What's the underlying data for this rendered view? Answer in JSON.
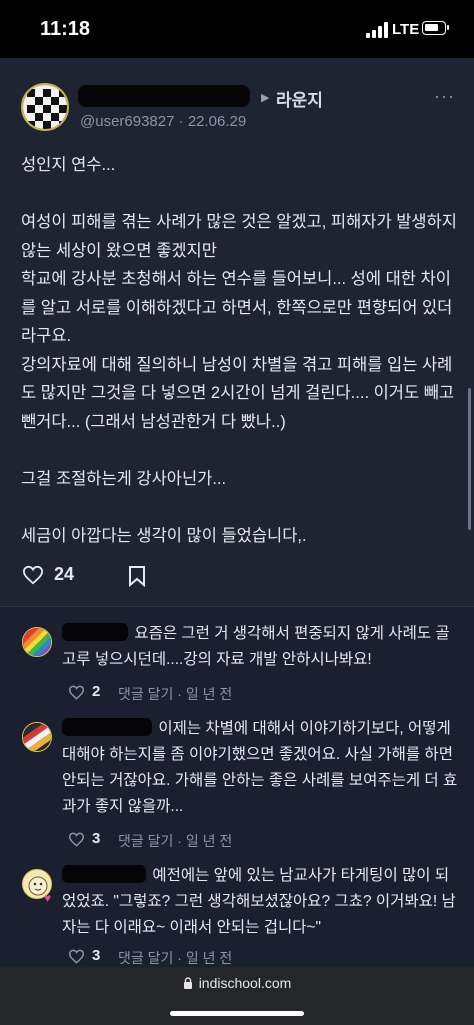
{
  "status_bar": {
    "time": "11:18",
    "network": "LTE"
  },
  "post": {
    "board": "라운지",
    "handle": "@user693827",
    "date": "22.06.29",
    "more": "···",
    "body": [
      "성인지 연수...",
      "",
      "여성이 피해를 겪는 사례가 많은 것은 알겠고, 피해자가 발생하지 않는 세상이 왔으면 좋겠지만",
      "학교에 강사분 초청해서 하는 연수를 들어보니... 성에 대한 차이를 알고 서로를 이해하겠다고 하면서, 한쪽으로만 편향되어 있더라구요.",
      "강의자료에 대해 질의하니 남성이 차별을 겪고 피해를 입는 사례도 많지만 그것을 다 넣으면 2시간이 넘게 걸린다.... 이거도 빼고 뺀거다... (그래서 남성관한거 다 빴나..)",
      "",
      "그걸 조절하는게 강사아닌가...",
      "",
      "세금이 아깝다는 생각이 많이 들었습니다,."
    ],
    "like_count": "24"
  },
  "comments": [
    {
      "text": "요즘은 그런 거 생각해서 편중되지 않게 사례도 골고루 넣으시던데....강의 자료 개발 안하시나봐요!",
      "likes": "2",
      "reply_label": "댓글 달기",
      "time": "일 년 전"
    },
    {
      "text": "이제는 차별에 대해서 이야기하기보다, 어떻게 대해야 하는지를 좀 이야기했으면 좋겠어요. 사실 가해를 하면 안되는 거잖아요. 가해를 안하는 좋은 사례를 보여주는게 더 효과가 좋지 않을까...",
      "likes": "3",
      "reply_label": "댓글 달기",
      "time": "일 년 전"
    },
    {
      "text": "예전에는 앞에 있는 남교사가 타게팅이 많이 되었었죠. \"그렇죠? 그런 생각해보셨잖아요? 그쵸? 이거봐요! 남자는 다 이래요~ 이래서 안되는 겁니다~\"",
      "likes": "3",
      "reply_label": "댓글 달기",
      "time": "일 년 전"
    }
  ],
  "browser": {
    "url": "indischool.com"
  },
  "colors": {
    "background": "#1f2433",
    "text": "#e6e8ef",
    "muted": "#8e94a3"
  }
}
